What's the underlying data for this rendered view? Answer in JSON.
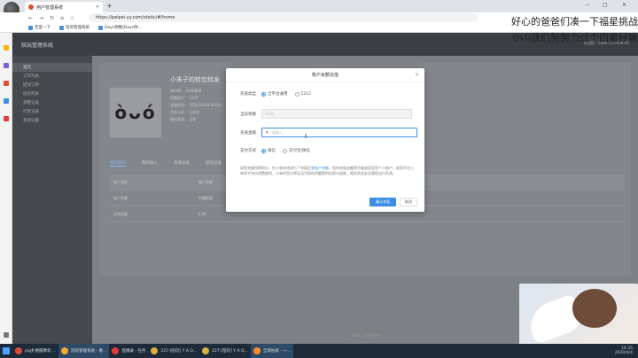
{
  "browser": {
    "tab_title": "用户管理系统",
    "new_tab": "+",
    "url": "https://peipei.yy.com/static/#/home",
    "win": {
      "min": "—",
      "max": "□",
      "close": "✕"
    },
    "bookmarks": [
      {
        "label": "百度一下"
      },
      {
        "label": "陪玩管理系统"
      },
      {
        "label": "Days倒数|Days倒..."
      }
    ]
  },
  "app": {
    "title": "陪玩管理系统",
    "user_text": "欢迎您：hawk (12345678)",
    "nav": [
      "首页",
      "订单列表",
      "提现订单",
      "陪玩列表",
      "调整记录",
      "打赏记录",
      "系统设置"
    ],
    "profile": {
      "face": "òᴗó",
      "name": "小朱子的转包转发",
      "lines": [
        "用户ID： 4156880",
        "所属用户： 1372",
        "注册时间： 2020-04-04 04:24",
        "实名认证： 已实名",
        "陪玩状态： 正常"
      ]
    },
    "tabs": [
      "我的钱包",
      "我的收入",
      "充值记录",
      "提现记录"
    ],
    "table": {
      "header": [
        "账户类型",
        "账户余额"
      ],
      "rows": [
        [
          "账户余额",
          "余额数值"
        ],
        [
          "冻结金额",
          "0.00"
        ]
      ]
    },
    "footer": "2020 © 版权所有"
  },
  "modal": {
    "title": "账户余额充值",
    "close": "×",
    "recharge_label": "充值类型",
    "recharge_opts": [
      "全平台通用",
      "5212"
    ],
    "balance_label": "当前余额",
    "balance_value": "0.00",
    "amount_label": "充值金额",
    "amount_prefix": "¥",
    "amount_placeholder": "请输入",
    "pay_label": "支付方式",
    "pay_opts": [
      "微信",
      "支付宝/微信"
    ],
    "note_a": "因您充值所得积分，在小朱伴侍进行了充值后到",
    "note_link": "账户余额",
    "note_b": "，您所充值金额将不能退回至您个人账户，若您不在小朱伴平台内消费使用，小朱伴官方将无法为您的余额提供担保与退款，相关资金安全请您自行负责。",
    "confirm": "确认充值",
    "cancel": "取消"
  },
  "overlay": [
    "好心的爸爸们凑一下福星挑战",
    "0v0我们努努力过个四星好嘛"
  ],
  "taskbar": {
    "items": [
      "pig扑猪摄像机 ...",
      "陪玩管理系统 - 看...",
      "直播录 - 任务",
      "227-[陪玩] Y A Q...",
      "227-[陪玩] Y A Q...",
      "全屏拍屏 - 一..."
    ],
    "time": "14:35",
    "date": "2020/4/4"
  }
}
